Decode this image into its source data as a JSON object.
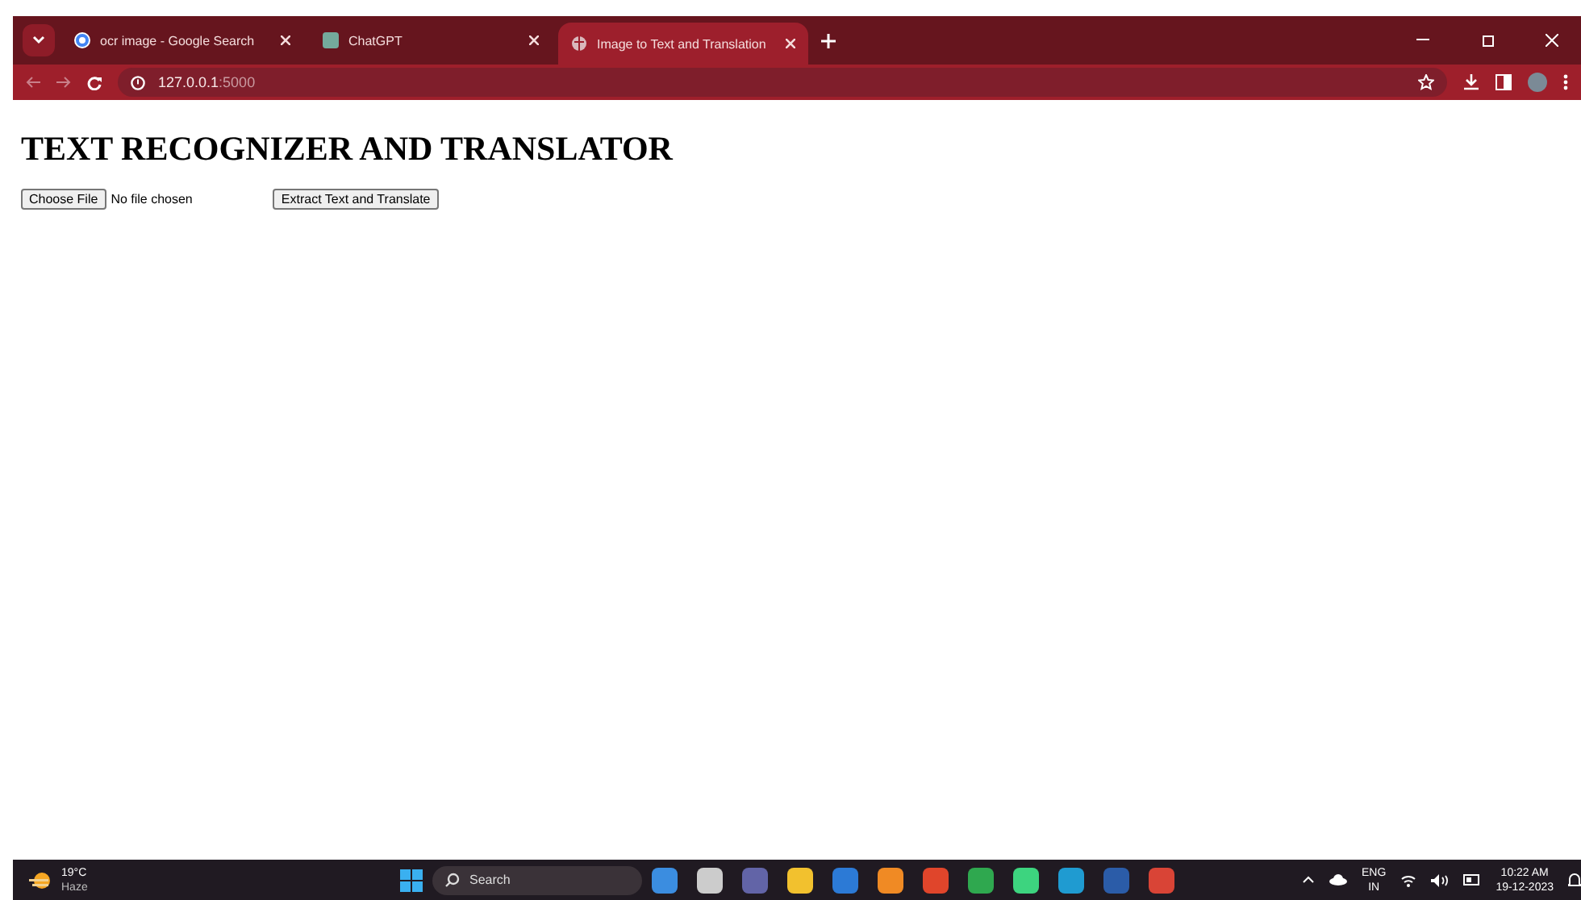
{
  "browser": {
    "tabs": [
      {
        "title": "ocr image - Google Search",
        "selected": false,
        "kind": "google"
      },
      {
        "title": "ChatGPT",
        "selected": false,
        "kind": "chat"
      },
      {
        "title": "Image to Text and Translation",
        "selected": true,
        "kind": "globe"
      }
    ],
    "address": {
      "host": "127.0.0.1",
      "port": ":5000"
    }
  },
  "page": {
    "heading": "TEXT RECOGNIZER AND TRANSLATOR",
    "file_button": "Choose File",
    "file_status": "No file chosen",
    "submit_button": "Extract Text and Translate"
  },
  "taskbar": {
    "weather": {
      "temperature": "19°C",
      "condition": "Haze"
    },
    "search": {
      "placeholder": "Search"
    },
    "tray": {
      "language": "ENG",
      "region": "IN",
      "time": "10:22 AM",
      "date": "19-12-2023"
    }
  }
}
